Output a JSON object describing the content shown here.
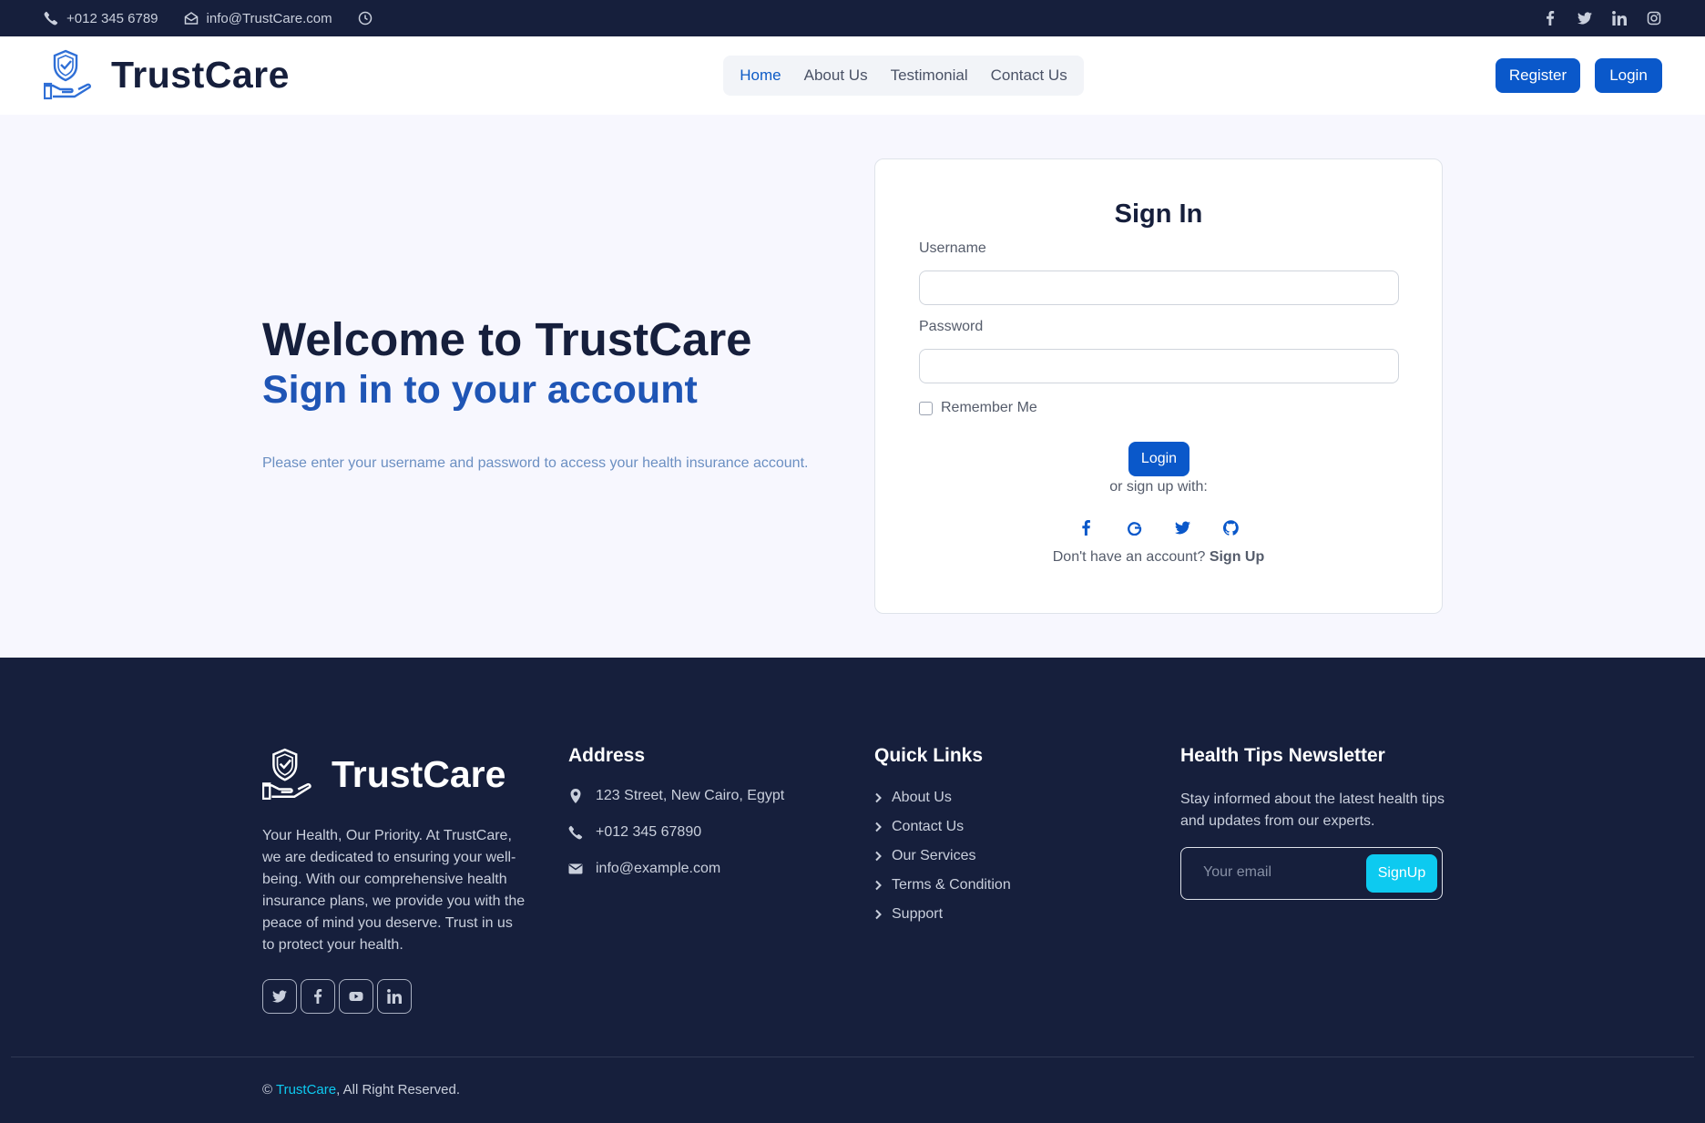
{
  "topbar": {
    "phone": "+012 345 6789",
    "email": "info@TrustCare.com",
    "icons": [
      "phone-icon",
      "envelope-icon",
      "clock-icon"
    ],
    "social_icons": [
      "facebook-icon",
      "twitter-icon",
      "linkedin-icon",
      "instagram-icon"
    ]
  },
  "header": {
    "brand": "TrustCare",
    "nav": [
      {
        "label": "Home",
        "active": true
      },
      {
        "label": "About Us"
      },
      {
        "label": "Testimonial"
      },
      {
        "label": "Contact Us"
      }
    ],
    "register_label": "Register",
    "login_label": "Login"
  },
  "hero": {
    "title": "Welcome to TrustCare",
    "subtitle": "Sign in to your account",
    "description": "Please enter your username and password to access your health insurance account."
  },
  "signin": {
    "title": "Sign In",
    "username_label": "Username",
    "username_value": "",
    "password_label": "Password",
    "password_value": "",
    "remember_label": "Remember Me",
    "login_label": "Login",
    "or_text": "or sign up with:",
    "social_icons": [
      "facebook-icon",
      "google-icon",
      "twitter-icon",
      "github-icon"
    ],
    "no_account_text": "Don't have an account?",
    "signup_link": "Sign Up"
  },
  "footer": {
    "brand": "TrustCare",
    "description": "Your Health, Our Priority. At TrustCare, we are dedicated to ensuring your well-being. With our comprehensive health insurance plans, we provide you with the peace of mind you deserve. Trust in us to protect your health.",
    "social_icons": [
      "twitter-icon",
      "facebook-icon",
      "youtube-icon",
      "linkedin-icon"
    ],
    "address_title": "Address",
    "address": {
      "street": "123 Street, New Cairo, Egypt",
      "phone": "+012 345 67890",
      "email": "info@example.com"
    },
    "links_title": "Quick Links",
    "links": [
      "About Us",
      "Contact Us",
      "Our Services",
      "Terms & Condition",
      "Support"
    ],
    "newsletter_title": "Health Tips Newsletter",
    "newsletter_desc": "Stay informed about the latest health tips and updates from our experts.",
    "email_placeholder": "Your email",
    "signup_button": "SignUp",
    "copyright_symbol": "©",
    "copyright_brand": "TrustCare",
    "copyright_rest": ", All Right Reserved."
  },
  "colors": {
    "navy": "#161f3c",
    "primary": "#0a58ca",
    "accent": "#0dcaf0",
    "hero_subtitle": "#1f55b5"
  }
}
